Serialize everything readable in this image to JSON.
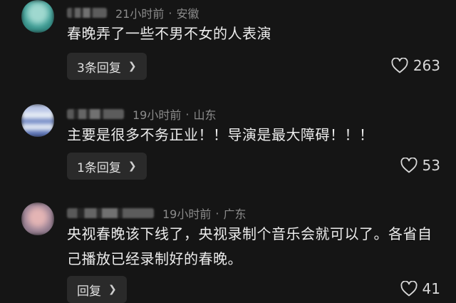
{
  "comments": [
    {
      "time": "21小时前",
      "location": "安徽",
      "text": "春晚弄了一些不男不女的人表演",
      "reply_label": "3条回复",
      "likes": "263"
    },
    {
      "time": "19小时前",
      "location": "山东",
      "text": "主要是很多不务正业！！导演是最大障碍！！！",
      "reply_label": "1条回复",
      "likes": "53"
    },
    {
      "time": "19小时前",
      "location": "广东",
      "text": "央视春晚该下线了，央视录制个音乐会就可以了。各省自己播放已经录制好的春晚。",
      "reply_label": "回复",
      "likes": "41"
    }
  ],
  "separator": "·",
  "icons": {
    "like": "heart-outline-icon",
    "chevron": "chevron-right-icon"
  }
}
